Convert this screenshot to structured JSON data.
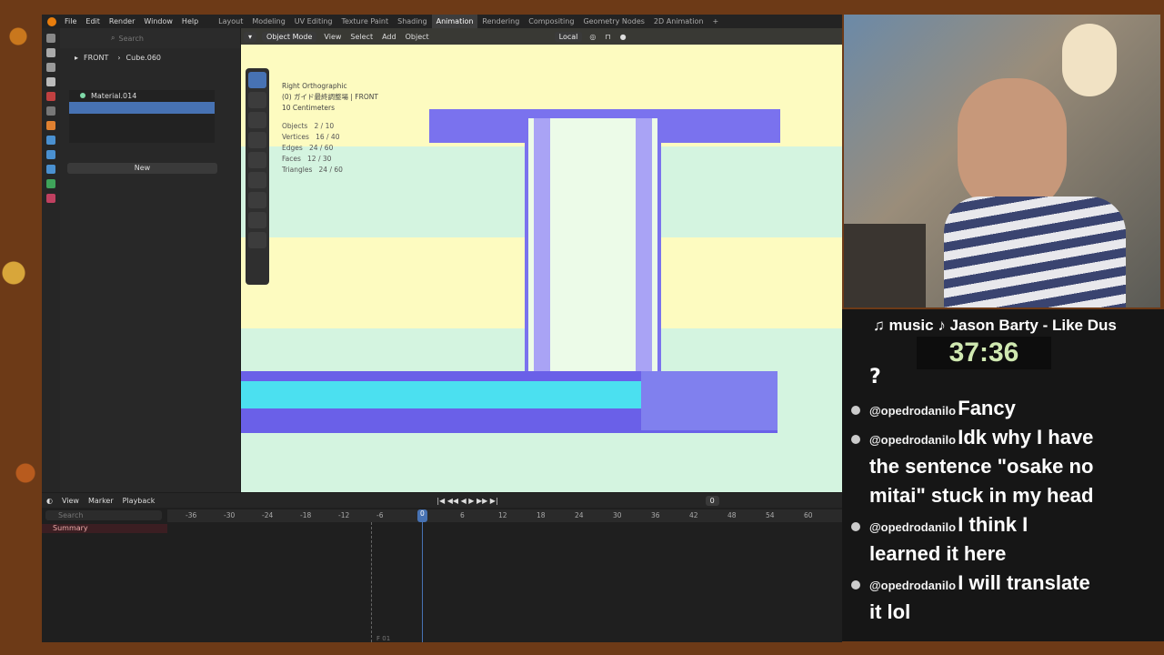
{
  "menu": [
    "File",
    "Edit",
    "Render",
    "Window",
    "Help"
  ],
  "workspaces": [
    "Layout",
    "Modeling",
    "UV Editing",
    "Texture Paint",
    "Shading",
    "Animation",
    "Rendering",
    "Compositing",
    "Geometry Nodes",
    "2D Animation",
    "+"
  ],
  "active_workspace": "Animation",
  "outliner": {
    "search_placeholder": "Search",
    "scene": "FRONT",
    "object": "Cube.060",
    "material": "Material.014",
    "new_label": "New"
  },
  "viewport": {
    "mode": "Object Mode",
    "menus": [
      "View",
      "Select",
      "Add",
      "Object"
    ],
    "orientation": "Local",
    "overlay": [
      "Right Orthographic",
      "(0) ガイド最終調整場 | FRONT",
      "10 Centimeters"
    ],
    "stats": [
      {
        "k": "Objects",
        "v": "2 / 10"
      },
      {
        "k": "Vertices",
        "v": "16 / 40"
      },
      {
        "k": "Edges",
        "v": "24 / 60"
      },
      {
        "k": "Faces",
        "v": "12 / 30"
      },
      {
        "k": "Triangles",
        "v": "24 / 60"
      }
    ]
  },
  "timeline": {
    "menus": [
      "View",
      "Marker",
      "Playback"
    ],
    "search_placeholder": "Search",
    "summary": "Summary",
    "frame": "0",
    "ticks": [
      "-36",
      "-30",
      "-24",
      "-18",
      "-12",
      "-6",
      "0",
      "6",
      "12",
      "18",
      "24",
      "30",
      "36",
      "42",
      "48",
      "54",
      "60",
      "66"
    ],
    "frame_label": "F 01"
  },
  "overlay": {
    "music": "♫ music ♪ Jason Barty - Like Dus",
    "timer": "37:36",
    "question": "?",
    "chat": [
      {
        "user": "@opedrodanilo",
        "text": "Fancy"
      },
      {
        "user": "@opedrodanilo",
        "text": "Idk why I have"
      },
      {
        "user": "",
        "text": "the sentence \"osake no"
      },
      {
        "user": "",
        "text": "mitai\" stuck in my head"
      },
      {
        "user": "@opedrodanilo",
        "text": "I think I"
      },
      {
        "user": "",
        "text": "learned it here"
      },
      {
        "user": "@opedrodanilo",
        "text": "I will translate"
      },
      {
        "user": "",
        "text": "it lol"
      }
    ]
  }
}
